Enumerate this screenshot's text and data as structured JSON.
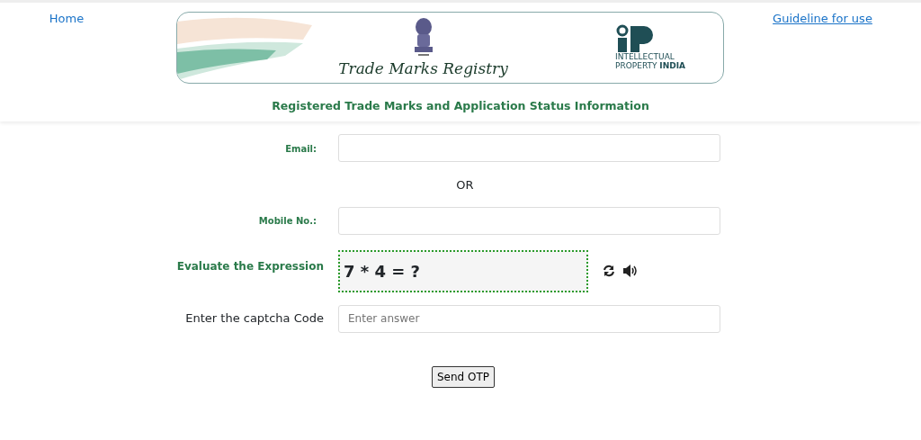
{
  "nav": {
    "home": "Home",
    "guideline": "Guideline for use"
  },
  "banner": {
    "title": "Trade Marks Registry",
    "logo_line1": "INTELLECTUAL",
    "logo_line2": "PROPERTY **INDIA**"
  },
  "subtitle": "Registered Trade Marks and Application Status Information",
  "form": {
    "email_label": "Email:",
    "or": "OR",
    "mobile_label": "Mobile No.:",
    "captcha_label": "Evaluate the Expression",
    "captcha_text": "7 * 4 = ?",
    "answer_label": "Enter the captcha Code",
    "answer_placeholder": "Enter answer",
    "submit": "Send OTP"
  }
}
